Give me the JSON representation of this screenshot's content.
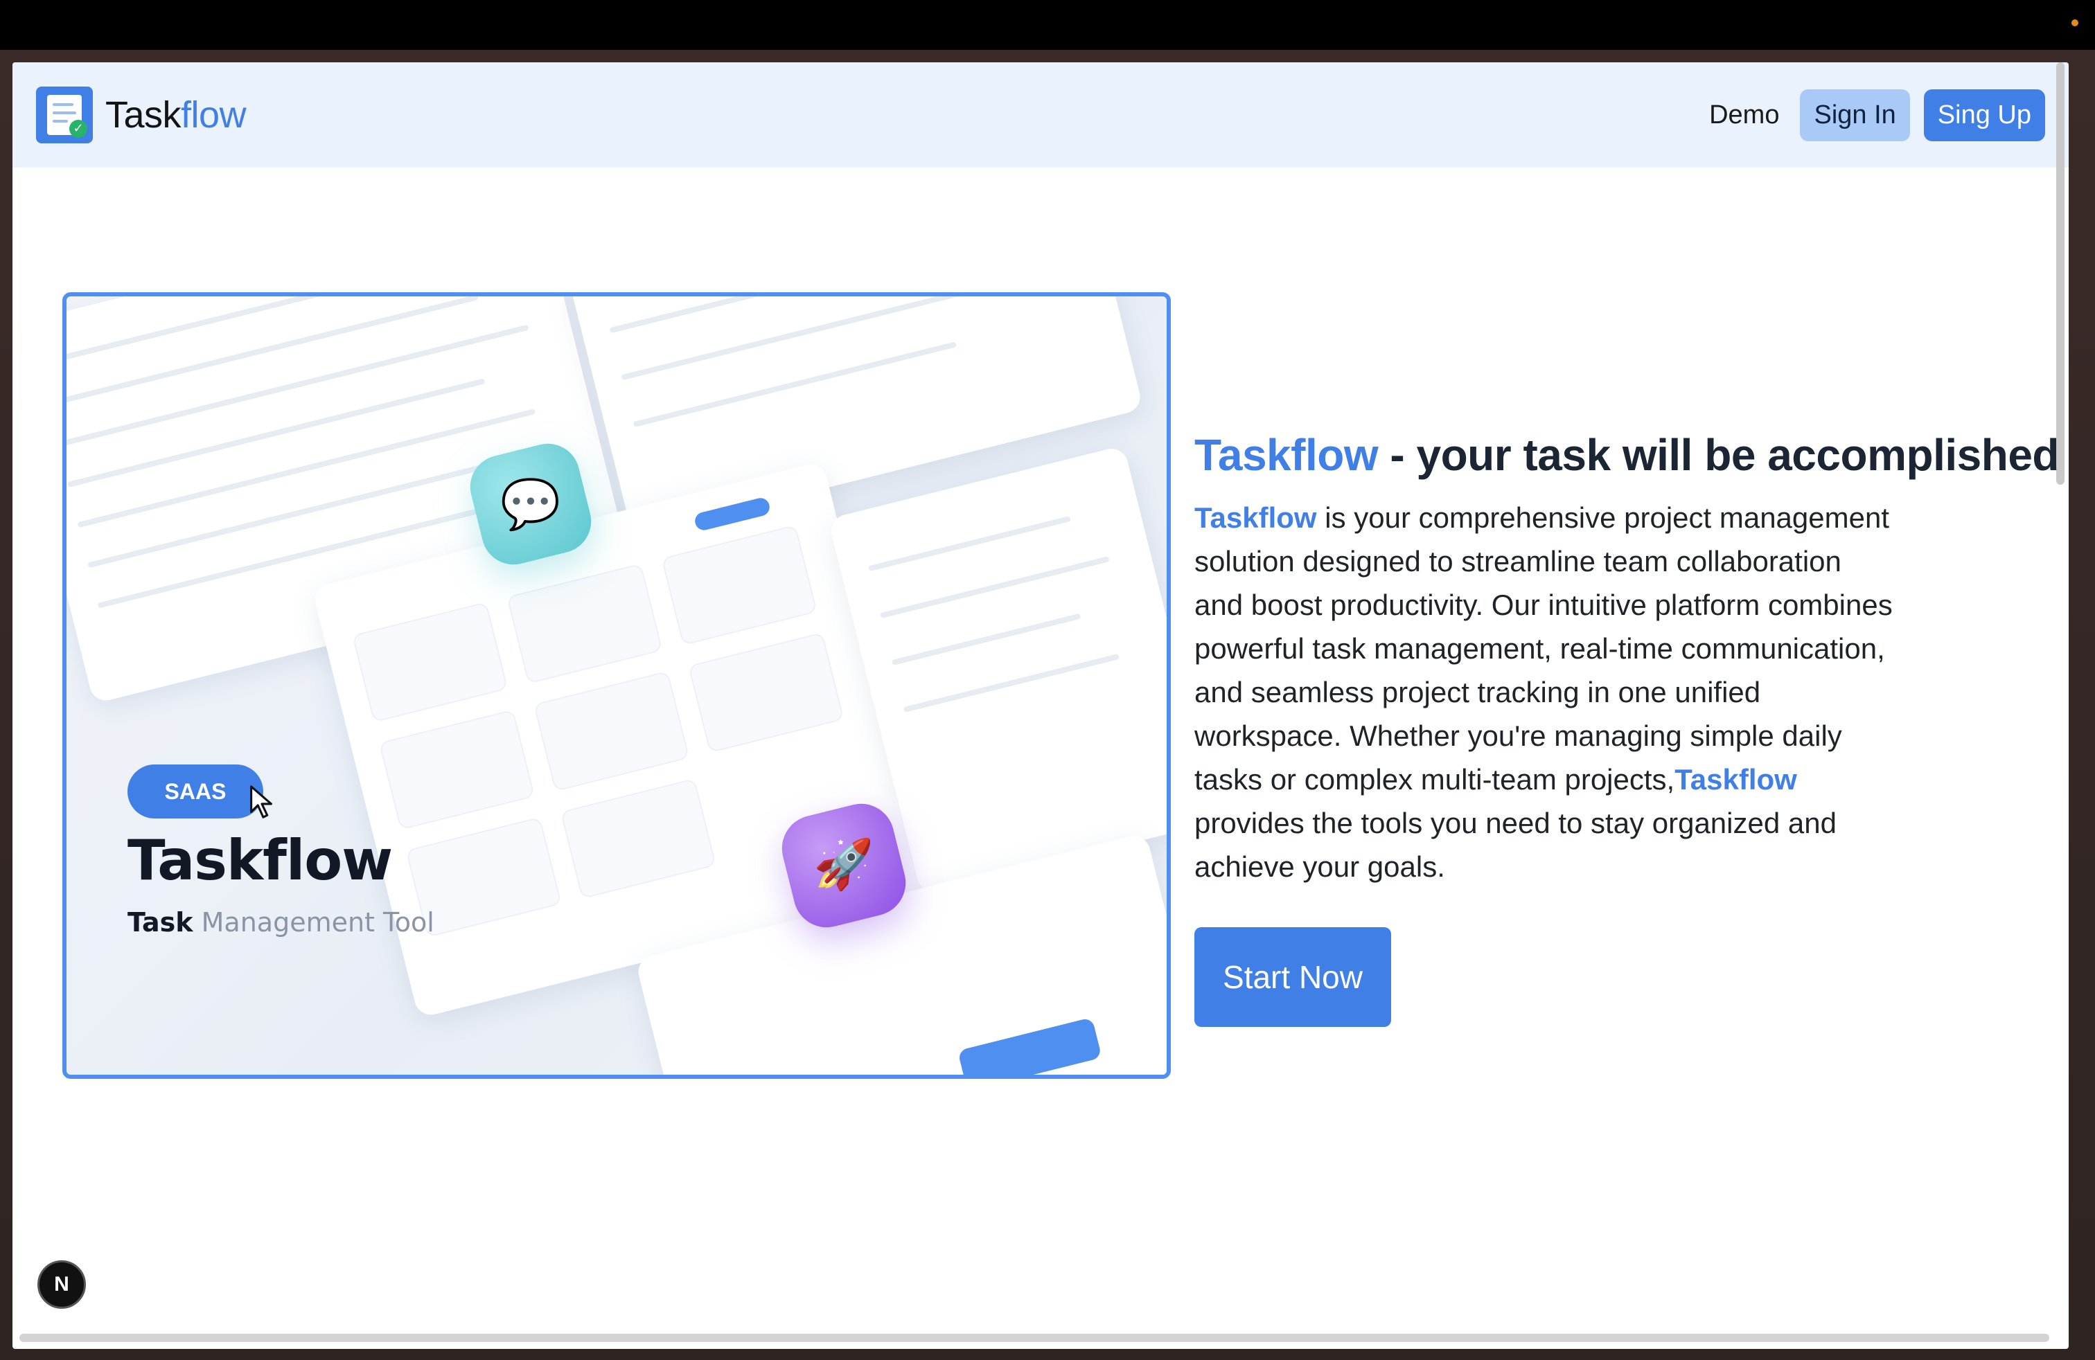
{
  "navbar": {
    "brand_prefix": "Task",
    "brand_suffix": "flow",
    "demo_label": "Demo",
    "signin_label": "Sign In",
    "signup_label": "Sing Up"
  },
  "hero_image": {
    "badge": "SAAS",
    "title": "Taskflow",
    "subtitle_bold": "Task",
    "subtitle_rest": " Management Tool"
  },
  "copy": {
    "headline_accent": "Taskflow",
    "headline_rest": " - your task will be accomplished",
    "para_brand_1": "Taskflow",
    "para_text_1": " is your comprehensive project management solution designed to streamline team collaboration and boost productivity. Our intuitive platform combines powerful task management, real-time communication, and seamless project tracking in one unified workspace. Whether you're managing simple daily tasks or complex multi-team projects,",
    "para_brand_2": "Taskflow",
    "para_text_2": " provides the tools you need to stay organized and achieve your goals.",
    "cta_label": "Start Now"
  },
  "dev_badge": "N",
  "colors": {
    "accent": "#3f7fe6",
    "nav_bg": "#eaf2fd",
    "signin_bg": "#a9c9f7"
  },
  "icons": {
    "logo": "taskflow-logo-icon",
    "chat": "chat-bubble-icon",
    "rocket": "rocket-icon",
    "cursor": "cursor-icon"
  }
}
